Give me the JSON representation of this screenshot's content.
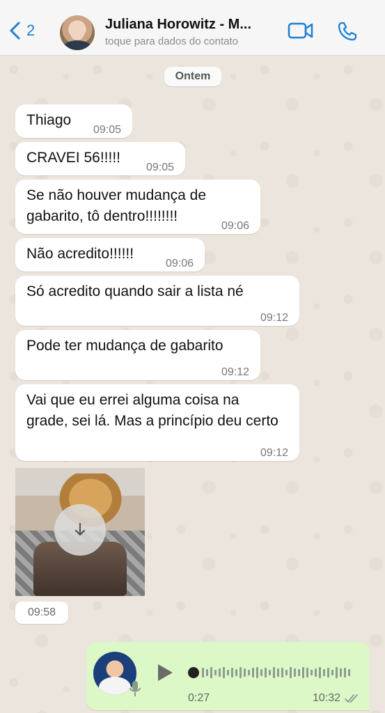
{
  "header": {
    "back_count": "2",
    "contact_name": "Juliana Horowitz - M...",
    "contact_subtitle": "toque para dados do contato"
  },
  "date_chip": "Ontem",
  "messages": [
    {
      "text": "Thiago",
      "time": "09:05"
    },
    {
      "text": "CRAVEI 56!!!!!",
      "time": "09:05"
    },
    {
      "text": "Se não houver mudança de gabarito, tô dentro!!!!!!!!",
      "time": "09:06"
    },
    {
      "text": "Não acredito!!!!!!",
      "time": "09:06"
    },
    {
      "text": "Só acredito quando sair a lista né",
      "time": "09:12"
    },
    {
      "text": "Pode ter mudança de gabarito",
      "time": "09:12"
    },
    {
      "text": "Vai que eu errei alguma coisa na grade, sei lá. Mas a princípio deu certo",
      "time": "09:12"
    }
  ],
  "media_message": {
    "time": "09:58"
  },
  "voice_message": {
    "duration": "0:27",
    "time": "10:32"
  },
  "colors": {
    "accent": "#1a7fd6",
    "outgoing_bubble": "#dcf8c6",
    "incoming_bubble": "#ffffff",
    "chat_background": "#efeae2"
  },
  "icons": [
    "chevron-left-icon",
    "video-camera-icon",
    "phone-icon",
    "download-icon",
    "play-icon",
    "microphone-icon",
    "double-check-icon"
  ]
}
